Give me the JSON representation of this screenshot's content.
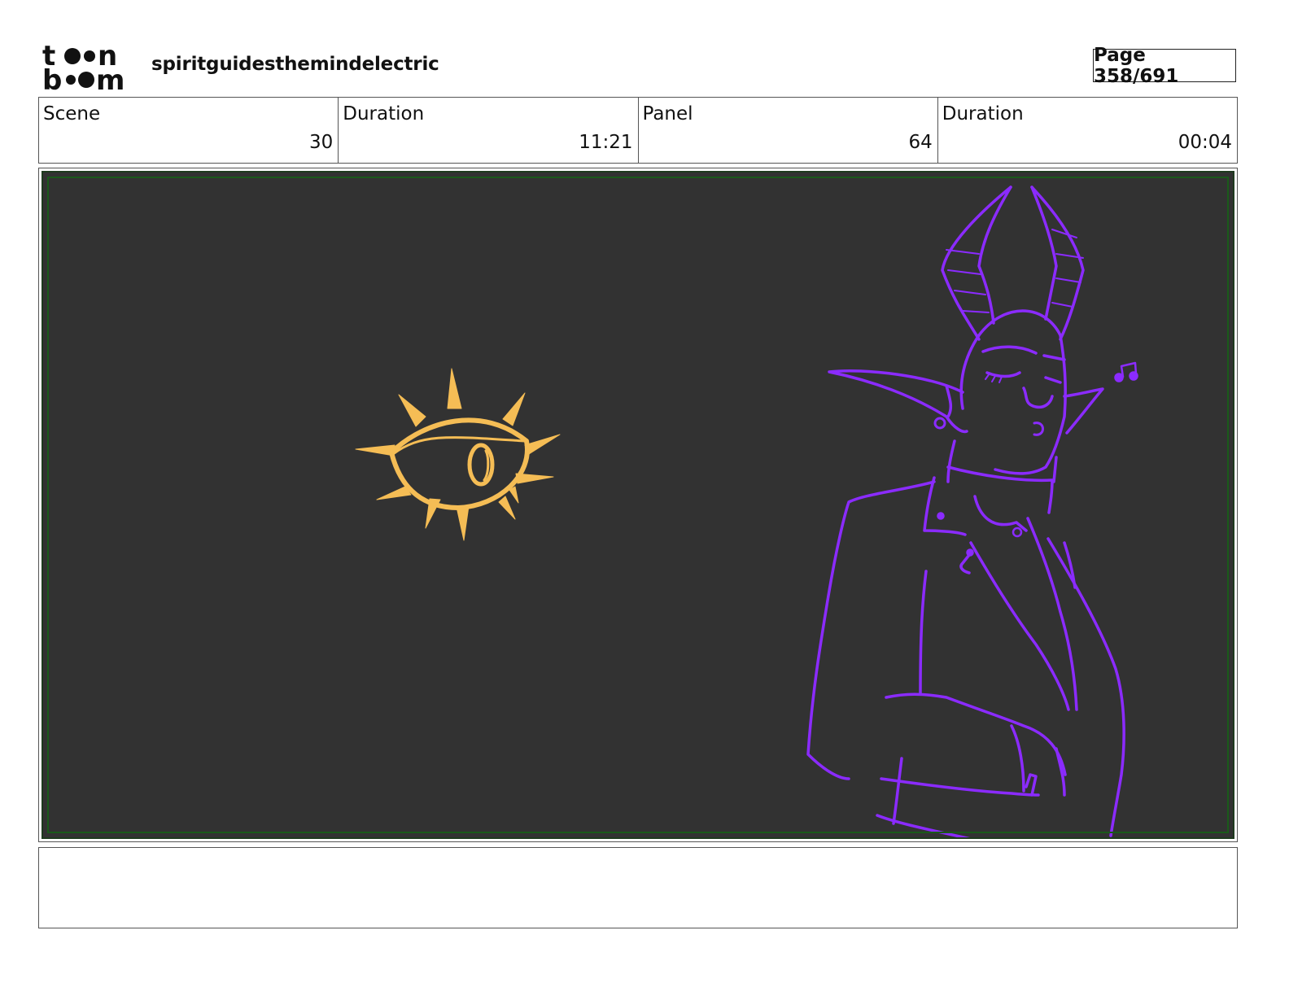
{
  "header": {
    "logo_text": "toon boom",
    "project_title": "spiritguidesthemindelectric",
    "page_label": "Page 358/691"
  },
  "info": {
    "scene_label": "Scene",
    "scene_value": "30",
    "scene_duration_label": "Duration",
    "scene_duration_value": "11:21",
    "panel_label": "Panel",
    "panel_value": "64",
    "panel_duration_label": "Duration",
    "panel_duration_value": "00:04"
  },
  "panel": {
    "background_color": "#323232",
    "sun_eye_color": "#f5bd55",
    "character_color": "#8b2bff",
    "safe_area_color": "#1a5a1a"
  },
  "notes": {
    "text": ""
  }
}
